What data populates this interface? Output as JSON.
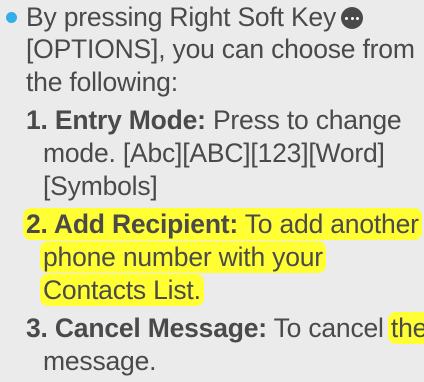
{
  "doc": {
    "intro": [
      "By pressing Right Soft Key",
      "[OPTIONS], you can choose from",
      "the following:"
    ],
    "softkey_icon": "ellipsis-softkey-icon",
    "items": [
      {
        "number_label": "1. Entry Mode:",
        "lines": [
          " Press to change",
          "mode. [Abc][ABC][123][Word]",
          "[Symbols]"
        ]
      },
      {
        "number_label": "2. Add Recipient:",
        "lines": [
          " To add another",
          "phone number with your",
          "Contacts List."
        ]
      },
      {
        "number_label": "3. Cancel Message:",
        "lines": [
          " To cancel ",
          "the",
          "message."
        ]
      }
    ],
    "colors": {
      "text": "#4a4a4a",
      "bullet": "#33aee6",
      "highlight": "#ffff33",
      "background": "#ebebeb"
    }
  }
}
